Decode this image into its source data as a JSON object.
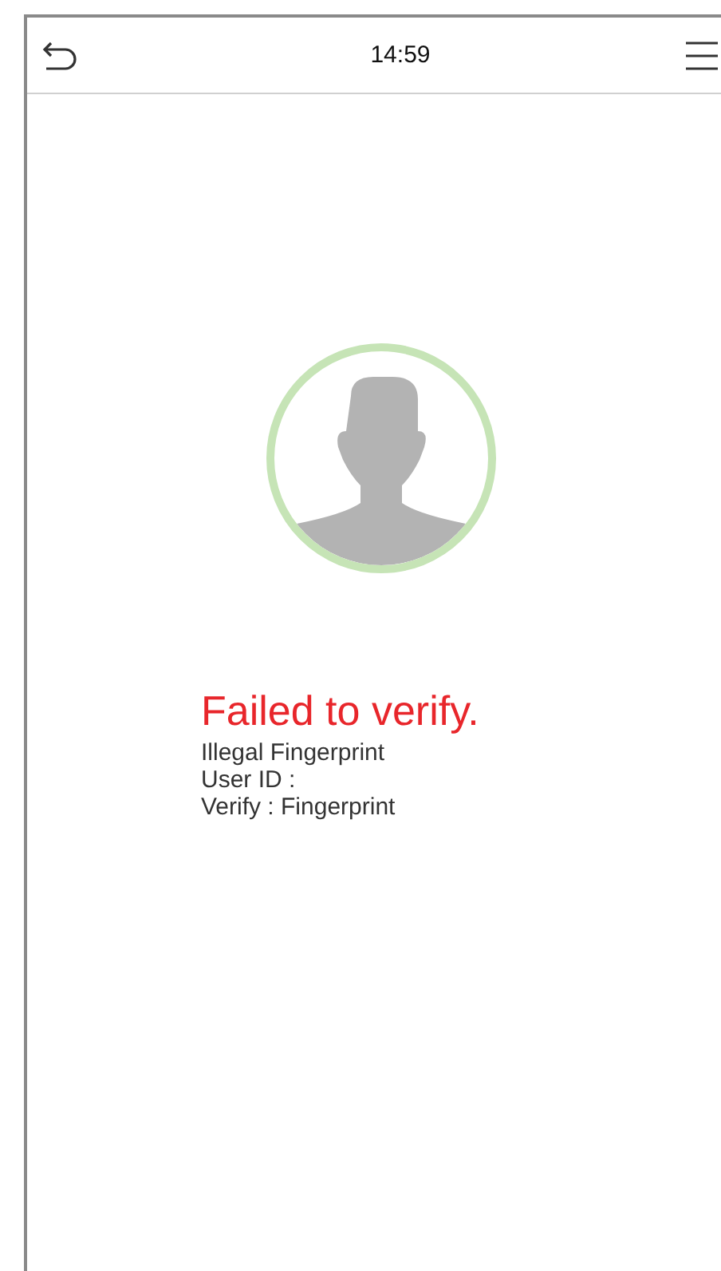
{
  "header": {
    "time": "14:59"
  },
  "result": {
    "title": "Failed to verify.",
    "lines": [
      "Illegal Fingerprint",
      "User ID :",
      "Verify : Fingerprint"
    ]
  }
}
